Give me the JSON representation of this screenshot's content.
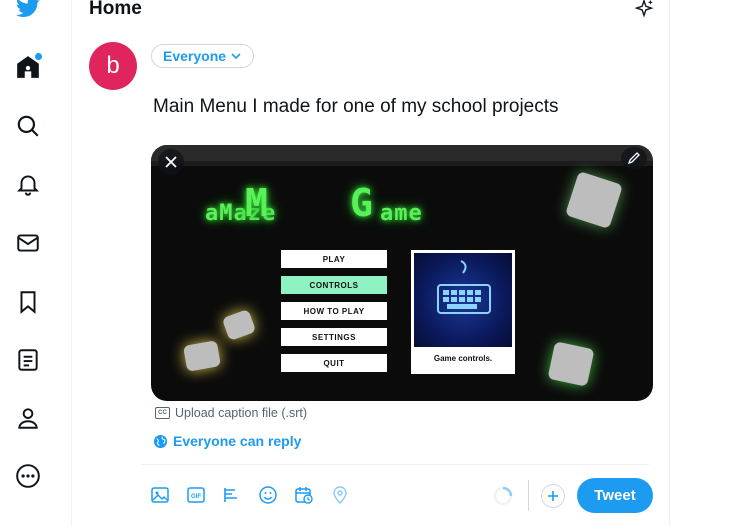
{
  "header": {
    "title": "Home"
  },
  "composer": {
    "avatar_letter": "b",
    "audience_label": "Everyone",
    "text": "Main Menu I made for one of my school projects",
    "caption_link": "Upload caption file (.srt)",
    "cc_label": "CC",
    "reply_setting": "Everyone can reply",
    "tweet_button": "Tweet"
  },
  "media": {
    "title_small_left": "aMaze",
    "title_big_m": "M",
    "title_big_g": "G",
    "title_small_right": "ame",
    "menu": [
      "PLAY",
      "CONTROLS",
      "HOW TO PLAY",
      "SETTINGS",
      "QUIT"
    ],
    "active_menu_index": 1,
    "preview_label": "Game controls."
  },
  "colors": {
    "accent": "#1d9bf0",
    "avatar": "#e0245e",
    "game_green": "#58f258",
    "menu_active": "#8ef2c2"
  }
}
